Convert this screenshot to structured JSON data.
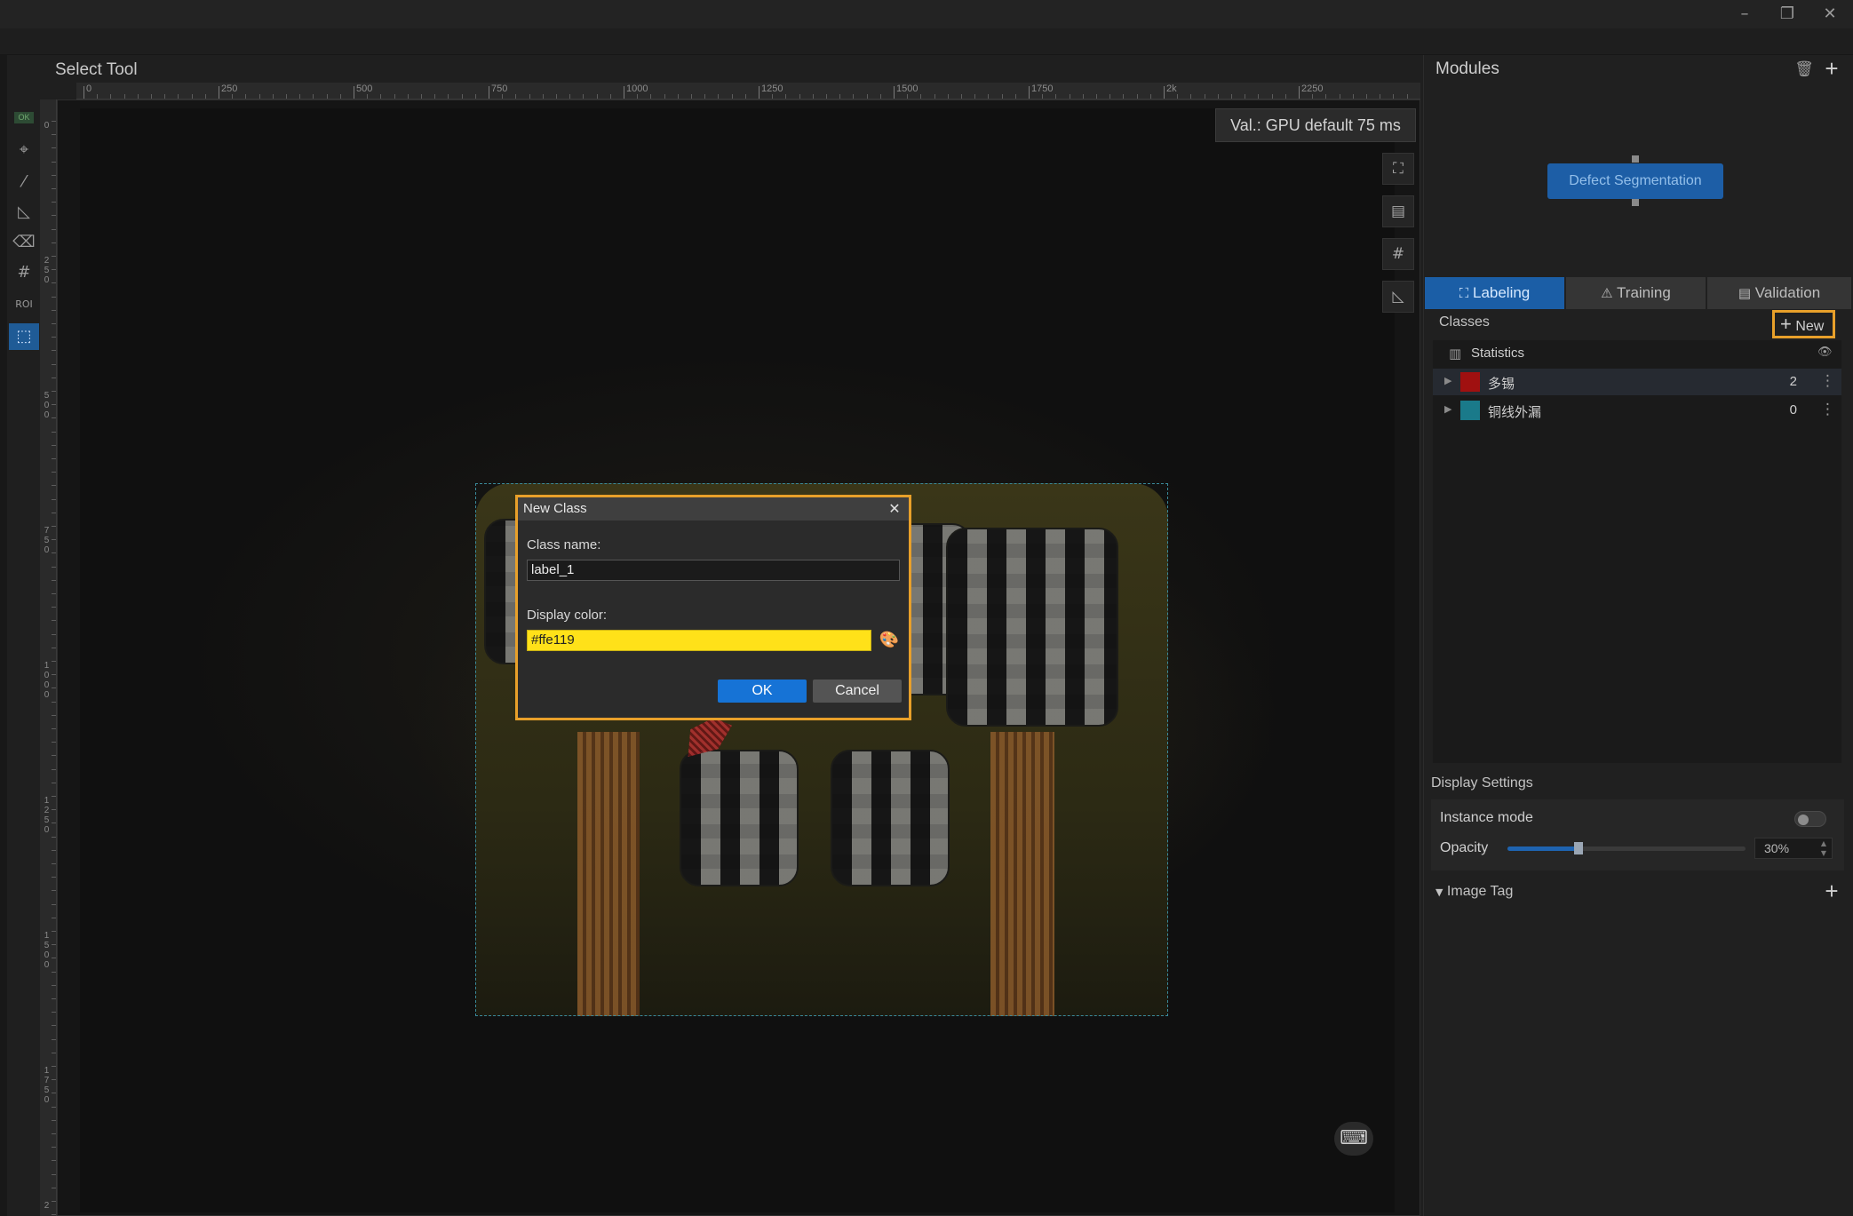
{
  "window": {
    "minimize_glyph": "–",
    "restore_glyph": "❐",
    "close_glyph": "✕"
  },
  "workspace": {
    "tool_title": "Select Tool",
    "validation_badge": "Val.:  GPU default 75 ms",
    "ok_badge": "OK",
    "ruler": {
      "h_labels": [
        "0",
        "250",
        "500",
        "750",
        "1000",
        "1250",
        "1500",
        "1750",
        "2k",
        "2250"
      ],
      "v_labels": [
        "0",
        "2\n5\n0",
        "5\n0\n0",
        "7\n5\n0",
        "1\n0\n0\n0",
        "1\n2\n5\n0",
        "1\n5\n0\n0",
        "1\n7\n5\n0",
        "2"
      ]
    },
    "tools": [
      {
        "name": "polygon-tool",
        "glyph": "⌖"
      },
      {
        "name": "magic-wand-tool",
        "glyph": "⁄"
      },
      {
        "name": "ruler-tool",
        "glyph": "◺"
      },
      {
        "name": "eraser-tool",
        "glyph": "⌫"
      },
      {
        "name": "grid-tool",
        "glyph": "#"
      },
      {
        "name": "roi-tool",
        "glyph": "ROI"
      },
      {
        "name": "select-tool",
        "glyph": "⬚"
      }
    ],
    "side_tools": [
      {
        "name": "show-labels-icon",
        "glyph": "⛶"
      },
      {
        "name": "show-predictions-icon",
        "glyph": "▤"
      },
      {
        "name": "show-grid-icon",
        "glyph": "#"
      },
      {
        "name": "show-roi-icon",
        "glyph": "◺"
      }
    ],
    "keyboard_glyph": "⌨"
  },
  "dialog": {
    "title": "New Class",
    "close_glyph": "✕",
    "class_name_label": "Class name:",
    "class_name_value": "label_1",
    "display_color_label": "Display color:",
    "display_color_value": "#ffe119",
    "display_color_swatch": "#ffe119",
    "palette_glyph": "🎨",
    "ok_label": "OK",
    "cancel_label": "Cancel"
  },
  "modules": {
    "title": "Modules",
    "trash_glyph": "🗑",
    "add_glyph": "+",
    "node_label": "Defect Segmentation"
  },
  "tabs": [
    {
      "label": "Labeling",
      "glyph": "⛶",
      "active": true
    },
    {
      "label": "Training",
      "glyph": "⚠",
      "active": false
    },
    {
      "label": "Validation",
      "glyph": "▤",
      "active": false
    }
  ],
  "classes": {
    "header": "Classes",
    "new_label": "New",
    "new_glyph": "+",
    "statistics_label": "Statistics",
    "statistics_glyph": "▥",
    "eye_glyph": "👁",
    "items": [
      {
        "name": "多锡",
        "count": "2",
        "color": "#a01010"
      },
      {
        "name": "铜线外漏",
        "count": "0",
        "color": "#1a7a8a"
      }
    ]
  },
  "display_settings": {
    "title": "Display Settings",
    "instance_mode_label": "Instance mode",
    "instance_mode_on": false,
    "opacity_label": "Opacity",
    "opacity_value": "30%",
    "opacity_fraction": 0.3
  },
  "image_tag": {
    "label": "Image Tag",
    "add_glyph": "+"
  }
}
